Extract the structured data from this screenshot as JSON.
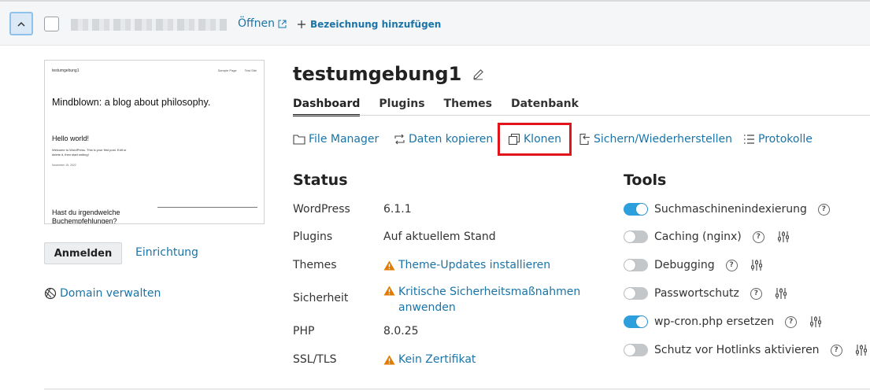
{
  "header": {
    "collapse_icon": "chevron-up-icon",
    "open_label": "Öffnen",
    "add_label": "Bezeichnung hinzufügen"
  },
  "preview": {
    "site_name": "testumgebung1",
    "nav": [
      "Sample Page",
      "Test Site"
    ],
    "headline": "Mindblown: a blog about philosophy.",
    "post_title": "Hello world!",
    "post_excerpt": "Welcome to WordPress. This is your first post. Edit or delete it, then start writing!",
    "post_date": "November 15, 2022",
    "question": "Hast du irgendwelche Buchempfehlungen?"
  },
  "sidebar": {
    "login_label": "Anmelden",
    "setup_label": "Einrichtung",
    "domain_label": "Domain verwalten"
  },
  "main": {
    "title": "testumgebung1",
    "tabs": [
      {
        "label": "Dashboard",
        "active": true
      },
      {
        "label": "Plugins",
        "active": false
      },
      {
        "label": "Themes",
        "active": false
      },
      {
        "label": "Datenbank",
        "active": false
      }
    ],
    "actions": [
      {
        "label": "File Manager",
        "icon": "folder-icon"
      },
      {
        "label": "Daten kopieren",
        "icon": "sync-icon"
      },
      {
        "label": "Klonen",
        "icon": "clone-icon"
      },
      {
        "label": "Sichern/Wiederherstellen",
        "icon": "backup-icon"
      },
      {
        "label": "Protokolle",
        "icon": "list-icon"
      }
    ]
  },
  "status": {
    "heading": "Status",
    "rows": [
      {
        "label": "WordPress",
        "value": "6.1.1"
      },
      {
        "label": "Plugins",
        "value": "Auf aktuellem Stand"
      },
      {
        "label": "Themes",
        "value": "Theme-Updates installieren"
      },
      {
        "label": "Sicherheit",
        "value": "Kritische Sicherheitsmaßnahmen anwenden"
      },
      {
        "label": "PHP",
        "value": "8.0.25"
      },
      {
        "label": "SSL/TLS",
        "value": "Kein Zertifikat"
      }
    ]
  },
  "tools": {
    "heading": "Tools",
    "items": [
      {
        "label": "Suchmaschinenindexierung",
        "on": true
      },
      {
        "label": "Caching (nginx)",
        "on": false
      },
      {
        "label": "Debugging",
        "on": false
      },
      {
        "label": "Passwortschutz",
        "on": false
      },
      {
        "label": "wp-cron.php ersetzen",
        "on": true
      },
      {
        "label": "Schutz vor Hotlinks aktivieren",
        "on": false
      }
    ]
  },
  "colors": {
    "link": "#1a74a8",
    "toggle_on": "#2d9fdd",
    "warning": "#e07b00",
    "highlight": "#e2141b"
  }
}
